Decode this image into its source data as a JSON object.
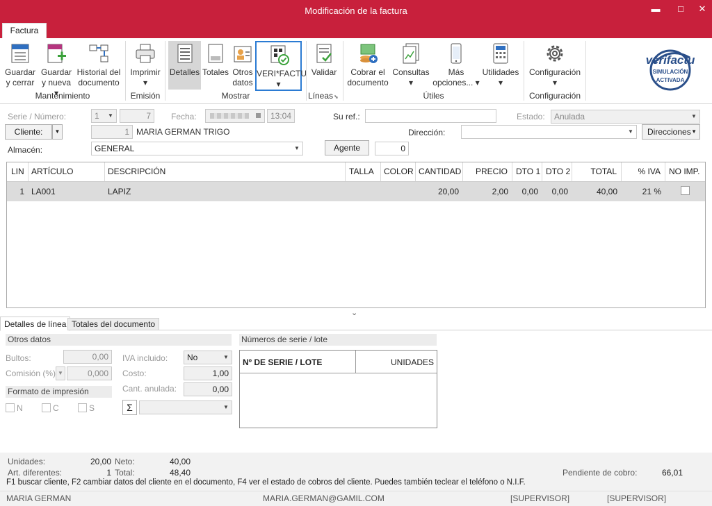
{
  "window": {
    "title": "Modificación de la factura",
    "minimize": "▬",
    "maximize": "□",
    "close": "✕"
  },
  "tab": {
    "label": "Factura"
  },
  "ribbon": {
    "buttons": {
      "guardar_cerrar": [
        "Guardar",
        "y cerrar"
      ],
      "guardar_nueva": [
        "Guardar",
        "y nueva ▾"
      ],
      "historial": [
        "Historial del",
        "documento"
      ],
      "imprimir": [
        "Imprimir",
        "▾"
      ],
      "detalles": [
        "Detalles"
      ],
      "totales": [
        "Totales"
      ],
      "otros_datos": [
        "Otros",
        "datos"
      ],
      "verifactu": [
        "VERI*FACTU",
        "▾"
      ],
      "validar": [
        "Validar"
      ],
      "cobrar": [
        "Cobrar el",
        "documento"
      ],
      "consultas": [
        "Consultas",
        "▾"
      ],
      "mas_opciones": [
        "Más",
        "opciones... ▾"
      ],
      "utilidades": [
        "Utilidades",
        "▾"
      ],
      "configuracion": [
        "Configuración",
        "▾"
      ]
    },
    "groups": {
      "mantenimiento": "Mantenimiento",
      "emision": "Emisión",
      "mostrar": "Mostrar",
      "lineas": "Líneas",
      "utiles": "Útiles",
      "configuracion": "Configuración"
    },
    "badge": {
      "brand": "verifactu",
      "line1": "SIMULACIÓN",
      "line2": "ACTIVADA"
    }
  },
  "header": {
    "serie_label": "Serie / Número:",
    "serie": "1",
    "numero": "7",
    "fecha_label": "Fecha:",
    "hora": "13:04",
    "suref_label": "Su ref.:",
    "suref": "",
    "estado_label": "Estado:",
    "estado": "Anulada",
    "cliente_button": "Cliente:",
    "cliente_num": "1",
    "cliente_name": "MARIA GERMAN TRIGO",
    "direccion_label": "Dirección:",
    "direccion": "",
    "direcciones_button": "Direcciones",
    "almacen_label": "Almacén:",
    "almacen": "GENERAL",
    "agente_button": "Agente",
    "agente": "0"
  },
  "grid": {
    "columns": [
      "LIN",
      "ARTÍCULO",
      "DESCRIPCIÓN",
      "TALLA",
      "COLOR",
      "CANTIDAD",
      "PRECIO",
      "DTO 1",
      "DTO 2",
      "TOTAL",
      "% IVA",
      "NO IMP."
    ],
    "rows": [
      {
        "lin": "1",
        "articulo": "LA001",
        "descripcion": "LAPIZ",
        "talla": "",
        "color": "",
        "cantidad": "20,00",
        "precio": "2,00",
        "dto1": "0,00",
        "dto2": "0,00",
        "total": "40,00",
        "iva": "21 %",
        "noimp": false
      }
    ]
  },
  "subtabs": [
    "Detalles de línea",
    "Totales del documento"
  ],
  "details": {
    "otros_datos": "Otros datos",
    "bultos_label": "Bultos:",
    "bultos": "0,00",
    "comision_label": "Comisión (%)",
    "comision": "0,000",
    "iva_incluido_label": "IVA incluido:",
    "iva_incluido": "No",
    "costo_label": "Costo:",
    "costo": "1,00",
    "cant_anulada_label": "Cant. anulada:",
    "cant_anulada": "0,00",
    "formato_label": "Formato de impresión",
    "check_n": "N",
    "check_c": "C",
    "check_s": "S",
    "sigma": "Σ",
    "series_title": "Números de serie / lote",
    "series_col1": "Nº DE SERIE / LOTE",
    "series_col2": "UNIDADES"
  },
  "footer": {
    "unidades_label": "Unidades:",
    "unidades": "20,00",
    "neto_label": "Neto:",
    "neto": "40,00",
    "art_label": "Art. diferentes:",
    "art": "1",
    "total_label": "Total:",
    "total": "48,40",
    "pendiente_label": "Pendiente de cobro:",
    "pendiente": "66,01",
    "hint": "F1 buscar cliente, F2 cambiar datos del cliente en el documento, F4 ver el estado de cobros del cliente. Puedes también teclear el teléfono o N.I.F.",
    "user": "MARIA GERMAN",
    "email": "MARIA.GERMAN@GAMIL.COM",
    "sup1": "[SUPERVISOR]",
    "sup2": "[SUPERVISOR]"
  }
}
